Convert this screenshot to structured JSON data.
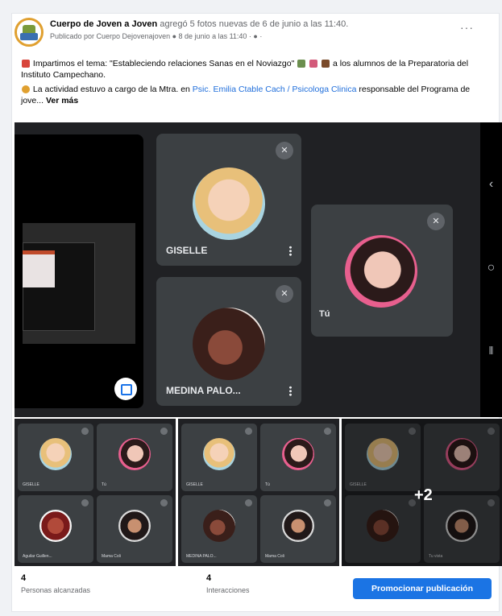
{
  "post": {
    "page_name": "Cuerpo de Joven a Joven",
    "action_text": "agregó 5 fotos nuevas de 6 de junio a las 11:40.",
    "sub_line": "Publicado por Cuerpo Dejovenajoven ● 8 de junio a las 11:40 · ● ·",
    "more_label": "···",
    "paragraph_1": "Impartimos el tema: \"Estableciendo relaciones Sanas en el Noviazgo\"",
    "paragraph_1_tail": "a los alumnos de la Preparatoria del Instituto Campechano.",
    "paragraph_2_pre": "La actividad estuvo a cargo de la Mtra. en",
    "paragraph_2_link": "Psic. Emilia Ctable Cach / Psicologa Clinica",
    "paragraph_2_post": "responsable del Programa de jove...",
    "see_more": "Ver más"
  },
  "photo_main": {
    "participants": [
      {
        "name": "GISELLE"
      },
      {
        "name": "Tú"
      },
      {
        "name": "MEDINA PALO..."
      }
    ],
    "icons": {
      "mute": "mic-off-icon",
      "more": "kebab-icon",
      "expand": "expand-icon",
      "back": "nav-back-icon",
      "home": "nav-home-icon",
      "recent": "nav-recent-icon"
    },
    "nav_glyphs": {
      "back": "‹",
      "home": "○",
      "recent": "⦀"
    }
  },
  "thumbnails": {
    "labels": {
      "giselle": "GISELLE",
      "tu": "Tú",
      "aguilar": "Aguilar Guillen...",
      "mama": "Mama Coli",
      "medina": "MEDINA PALO...",
      "tu_mini": "Tú",
      "mama_extra": "Tu vista"
    },
    "more_count": "+2"
  },
  "stats": {
    "reach_count": "4",
    "reach_label": "Personas alcanzadas",
    "engagement_count": "4",
    "engagement_label": "Interacciones"
  },
  "actions": {
    "promote_label": "Promocionar publicación"
  },
  "colors": {
    "brand_blue": "#1b74e4",
    "link_blue": "#216fdb",
    "meet_bg": "#202124",
    "tile_bg": "#3c4043"
  }
}
